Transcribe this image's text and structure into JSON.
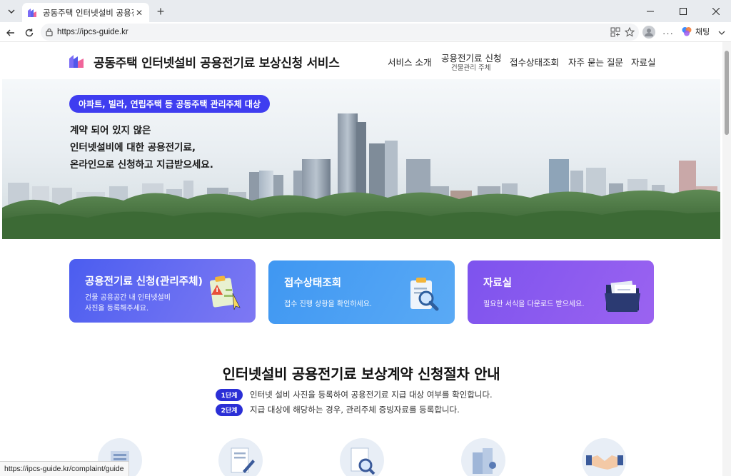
{
  "browser": {
    "tab_title": "공동주택 인터넷설비 공용전기료 보",
    "url": "https://ipcs-guide.kr",
    "copilot_label": "채팅",
    "status_url": "https://ipcs-guide.kr/complaint/guide"
  },
  "site": {
    "title": "공동주택 인터넷설비 공용전기료 보상신청 서비스",
    "nav": [
      {
        "label": "서비스 소개"
      },
      {
        "label": "공용전기료 신청",
        "sub": "건물관리 주체"
      },
      {
        "label": "접수상태조회"
      },
      {
        "label": "자주 묻는 질문"
      },
      {
        "label": "자료실"
      }
    ]
  },
  "hero": {
    "badge": "아파트, 빌라, 연립주택 등 공동주택 관리주체 대상",
    "lines": [
      "계약 되어 있지 않은",
      "인터넷설비에 대한 공용전기료,",
      "온라인으로 신청하고 지급받으세요."
    ]
  },
  "cards": [
    {
      "title": "공용전기료 신청(관리주체)",
      "desc1": "건물 공용공간 내 인터넷설비",
      "desc2": "사진을 등록해주세요.",
      "icon": "clipboard-warning-icon"
    },
    {
      "title": "접수상태조회",
      "desc1": "접수 진행 상황을 확인하세요.",
      "icon": "clipboard-magnifier-icon"
    },
    {
      "title": "자료실",
      "desc1": "필요한 서식을 다운로드 받으세요.",
      "icon": "folder-icon"
    }
  ],
  "process": {
    "title": "인터넷설비 공용전기료 보상계약 신청절차 안내",
    "steps": [
      {
        "badge": "1단계",
        "text": "인터넷 설비 사진을 등록하여 공용전기료 지급 대상 여부를 확인합니다."
      },
      {
        "badge": "2단계",
        "text": "지급 대상에 해당하는 경우, 관리주체 증빙자료를 등록합니다."
      }
    ]
  },
  "colors": {
    "accent": "#3f3df0",
    "card1": "#5b63ee",
    "card2": "#4ea4f4",
    "card3": "#8f5bef"
  }
}
